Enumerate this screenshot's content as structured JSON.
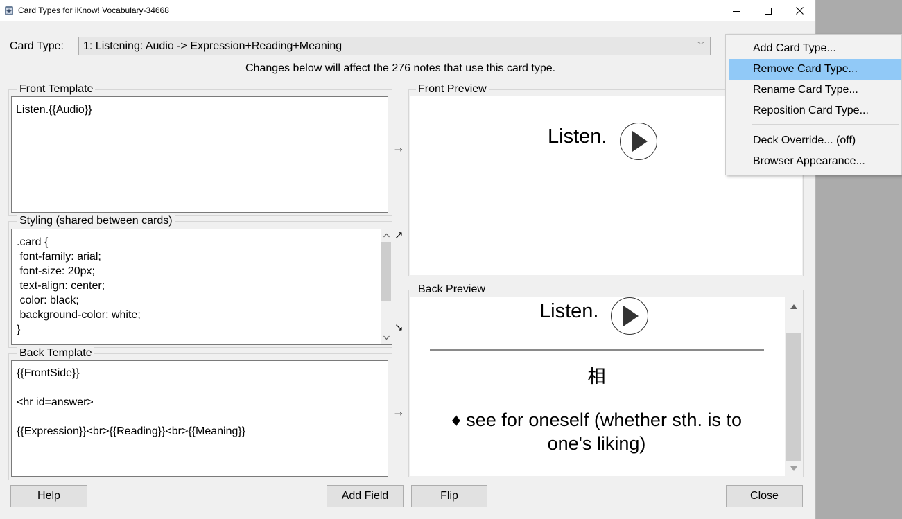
{
  "window": {
    "title": "Card Types for iKnow! Vocabulary-34668",
    "minimize_glyph": "─",
    "maximize_glyph": "☐",
    "close_glyph": "✕"
  },
  "card_type": {
    "label": "Card Type:",
    "selected": "1: Listening: Audio -> Expression+Reading+Meaning",
    "notice": "Changes below will affect the 276 notes that use this card type."
  },
  "front_template": {
    "title": "Front Template",
    "content": "Listen.{{Audio}}"
  },
  "styling": {
    "title": "Styling (shared between cards)",
    "lines": [
      ".card {",
      " font-family: arial;",
      " font-size: 20px;",
      " text-align: center;",
      " color: black;",
      " background-color: white;",
      "}"
    ]
  },
  "back_template": {
    "title": "Back Template",
    "lines": [
      "{{FrontSide}}",
      "",
      "<hr id=answer>",
      "",
      "{{Expression}}<br>{{Reading}}<br>{{Meaning}}"
    ]
  },
  "front_preview": {
    "title": "Front Preview",
    "text": "Listen."
  },
  "back_preview": {
    "title": "Back Preview",
    "text": "Listen.",
    "expression": "相",
    "meaning_line1": "♦ see for oneself (whether sth. is to",
    "meaning_line2": "one's liking)"
  },
  "arrows": {
    "right": "→",
    "up_right": "↗",
    "down_right": "↘"
  },
  "buttons": {
    "help": "Help",
    "add_field": "Add Field",
    "flip": "Flip",
    "close": "Close"
  },
  "options_menu": {
    "items": [
      "Add Card Type...",
      "Remove Card Type...",
      "Rename Card Type...",
      "Reposition Card Type...",
      "Deck Override... (off)",
      "Browser Appearance..."
    ],
    "highlighted_index": 1
  },
  "colors": {
    "menu_highlight": "#91c9f7",
    "window_bg": "#f0f0f0"
  }
}
